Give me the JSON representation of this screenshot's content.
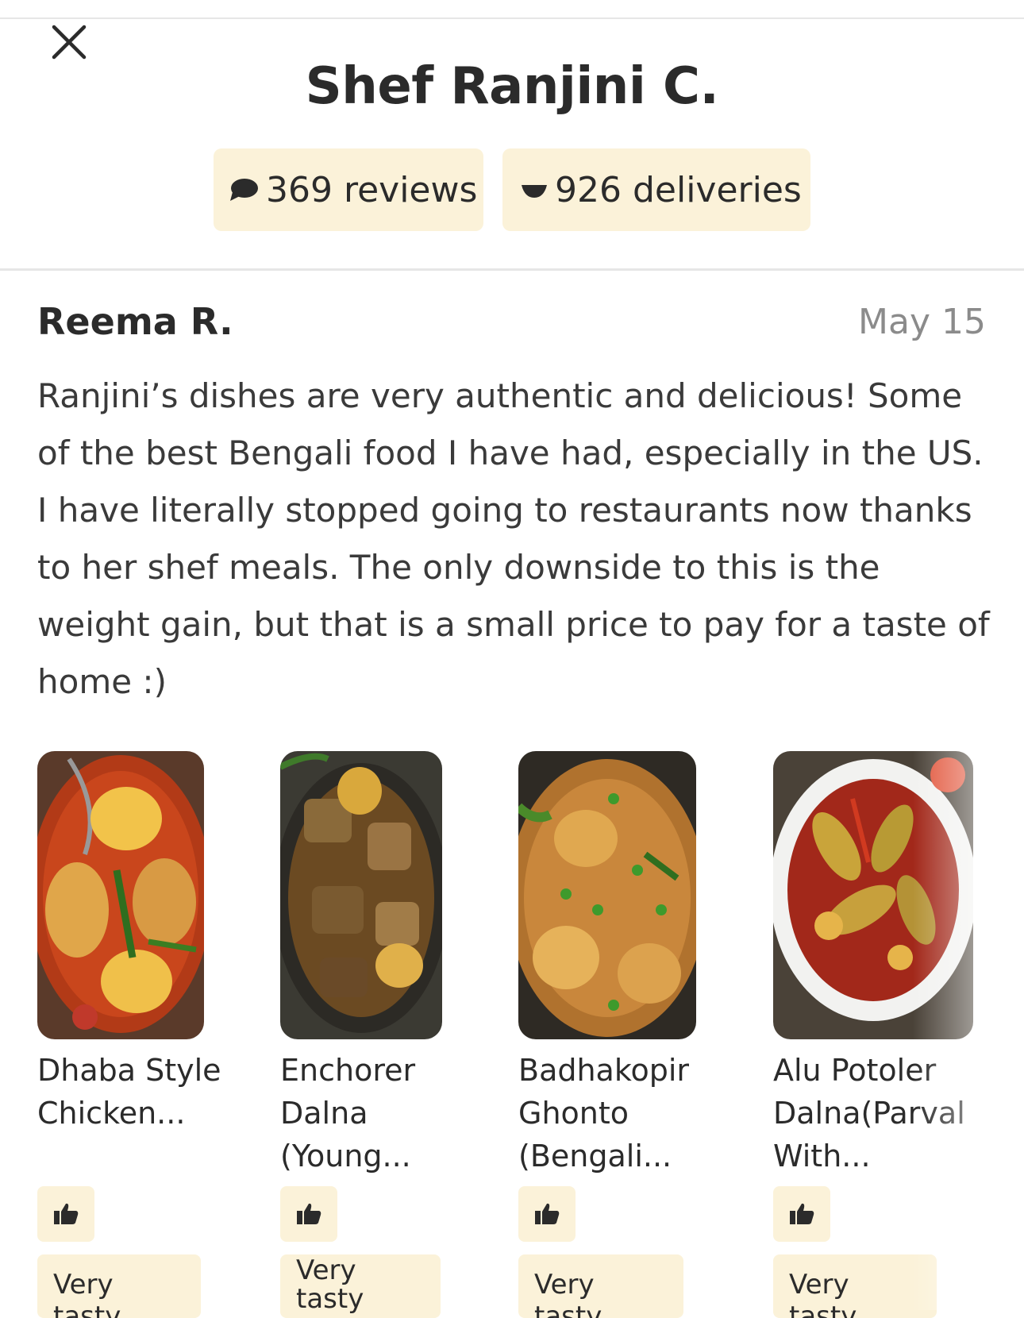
{
  "header": {
    "close_icon": "close-icon",
    "title": "Shef Ranjini C.",
    "reviews_label": "369 reviews",
    "deliveries_label": "926 deliveries"
  },
  "review": {
    "author": "Reema R.",
    "date": "May 15",
    "text": "Ranjini’s dishes are very authentic and delicious! Some of the best Bengali food I have had, especially in the US. I have literally stopped going to restaurants now thanks to her shef meals. The only downside to this is the weight gain, but that is a small price to pay for a taste of home :)"
  },
  "dishes": [
    {
      "name": "Dhaba Style Chicken...",
      "tag": "Very tasty",
      "like_icon": "thumbs-up-icon"
    },
    {
      "name": "Enchorer Dalna (Young...",
      "tag": "Very tasty",
      "like_icon": "thumbs-up-icon"
    },
    {
      "name": "Badhakopir Ghonto (Bengali...",
      "tag": "Very tasty",
      "like_icon": "thumbs-up-icon"
    },
    {
      "name": "Alu Potoler Dalna(Parval With...",
      "tag": "Very tasty",
      "like_icon": "thumbs-up-icon"
    }
  ],
  "colors": {
    "pill_bg": "#fbf2d9",
    "text": "#2b2b2b",
    "muted": "#8b8b8b"
  }
}
